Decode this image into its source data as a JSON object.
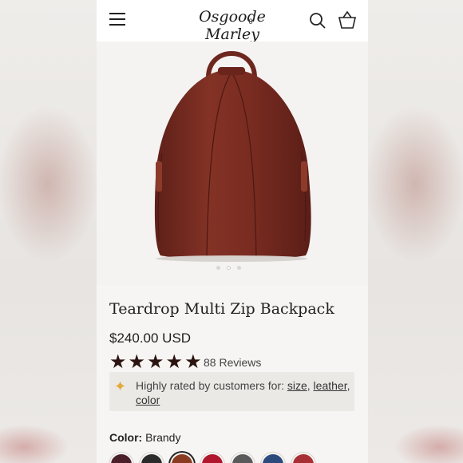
{
  "header": {
    "logo": "Osgoode Marley",
    "cart_count": "0",
    "icons": [
      "menu-icon",
      "search-icon",
      "basket-icon"
    ]
  },
  "product": {
    "title": "Teardrop Multi Zip Backpack",
    "price": "$240.00 USD",
    "rating": 5,
    "rating_max": 5,
    "reviews_label": "88 Reviews",
    "image_count": 3,
    "image_active": 2
  },
  "highlight": {
    "prefix": "Highly rated by customers for:",
    "tags": [
      "size",
      "leather",
      "color"
    ],
    "icon": "sparkle-icon"
  },
  "color": {
    "label": "Color:",
    "selected": "Brandy"
  },
  "swatches": [
    {
      "name": "plum",
      "hex": "#4a1f2a"
    },
    {
      "name": "black",
      "hex": "#2b2b2b"
    },
    {
      "name": "brandy",
      "hex": "#8a3b22",
      "selected": true
    },
    {
      "name": "red",
      "hex": "#b0172c"
    },
    {
      "name": "grey",
      "hex": "#5a5a5c"
    },
    {
      "name": "navy",
      "hex": "#2c4a7c"
    },
    {
      "name": "crimson",
      "hex": "#a83035"
    }
  ],
  "colors": {
    "product_leather": "#7b2d22",
    "star": "#2a1310",
    "sparkle": "#e3a93a"
  }
}
